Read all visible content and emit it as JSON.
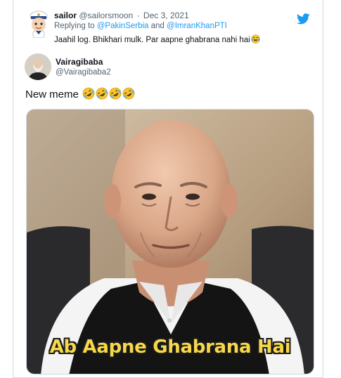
{
  "reply": {
    "name": "sailor",
    "handle": "@sailorsmoon",
    "separator": "·",
    "date": "Dec 3, 2021",
    "replying_prefix": "Replying to",
    "mention_1": "@PakinSerbia",
    "mention_joiner": "and",
    "mention_2": "@ImranKhanPTI",
    "text": "Jaahil log. Bhikhari mulk. Par aapne ghabrana nahi hai"
  },
  "author": {
    "name": "Vairagibaba",
    "handle": "@Vairagibaba2"
  },
  "tweet": {
    "text": "New meme"
  },
  "meme": {
    "caption": "Ab Aapne Ghabrana Hai"
  },
  "colors": {
    "accent": "#1d9bf0",
    "text_secondary": "#536471",
    "border": "#cfd9de",
    "caption_fill": "#f6d84a"
  },
  "icons": {
    "brand": "twitter-bird-icon",
    "reaction_emoji": "face-with-tears-of-joy-icon",
    "tweet_emojis": [
      "rolling-on-floor-laughing-icon",
      "rolling-on-floor-laughing-icon",
      "rolling-on-floor-laughing-icon",
      "rolling-on-floor-laughing-icon"
    ]
  }
}
